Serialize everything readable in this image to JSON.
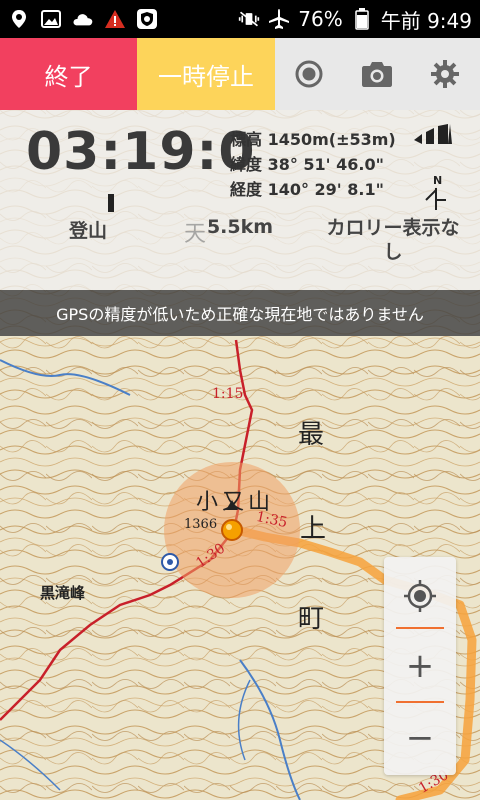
{
  "status_bar": {
    "battery": "76%",
    "time": "午前 9:49"
  },
  "toolbar": {
    "end_label": "終了",
    "pause_label": "一時停止"
  },
  "info": {
    "timer": "03:19:0",
    "elevation": "標高 1450m(±53m)",
    "latitude": "緯度 38° 51' 46.0\"",
    "longitude": "経度 140° 29' 8.1\"",
    "activity": "登山",
    "distance": "5.5km",
    "calorie": "カロリー表示なし"
  },
  "gps_warning": "GPSの精度が低いため正確な現在地ではありません",
  "map": {
    "peak_name": "小又山",
    "peak_elevation": "1366",
    "place_left": "黒滝峰",
    "town_chars": [
      "最",
      "上",
      "町"
    ],
    "route_times": [
      "1:15",
      "1:35",
      "1:30",
      "1:30"
    ],
    "sky_char": "天"
  },
  "zoom": {
    "plus": "+",
    "minus": "−"
  },
  "colors": {
    "end": "#f2405f",
    "pause": "#fdd45a",
    "route_red": "#c8202a",
    "track_orange": "#f7a23b"
  }
}
